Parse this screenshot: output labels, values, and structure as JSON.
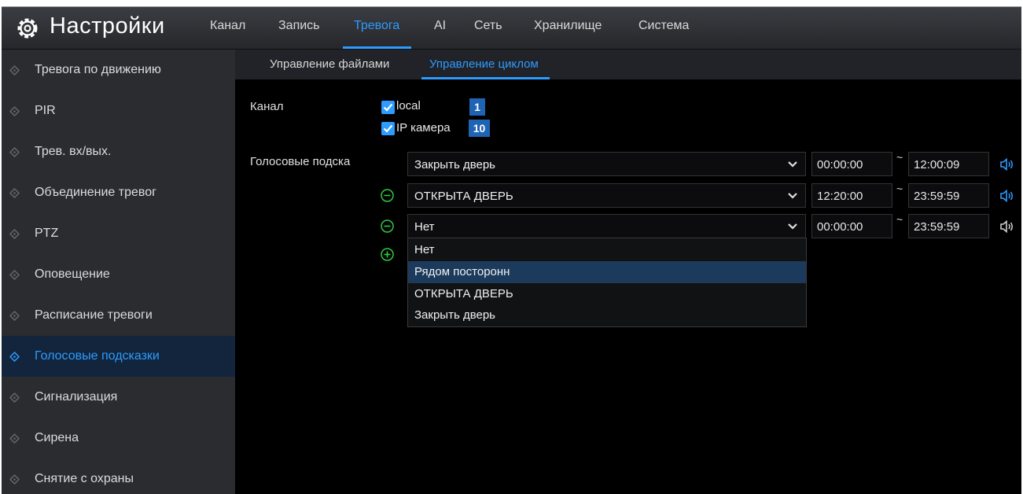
{
  "header": {
    "title": "Настройки",
    "tabs": [
      {
        "label": "Канал"
      },
      {
        "label": "Запись"
      },
      {
        "label": "Тревога"
      },
      {
        "label": "AI"
      },
      {
        "label": "Сеть"
      },
      {
        "label": "Хранилище"
      },
      {
        "label": "Система"
      }
    ],
    "active_tab": "Тревога"
  },
  "sidebar": {
    "items": [
      {
        "label": "Тревога по движению"
      },
      {
        "label": "PIR"
      },
      {
        "label": "Трев. вх/вых."
      },
      {
        "label": "Объединение тревог"
      },
      {
        "label": "PTZ"
      },
      {
        "label": "Оповещение"
      },
      {
        "label": "Расписание тревоги"
      },
      {
        "label": "Голосовые подсказки"
      },
      {
        "label": "Сигнализация"
      },
      {
        "label": "Сирена"
      },
      {
        "label": "Снятие с охраны"
      }
    ],
    "active_item": "Голосовые подсказки"
  },
  "subtabs": [
    {
      "label": "Управление файлами"
    },
    {
      "label": "Управление циклом"
    }
  ],
  "channel": {
    "label": "Канал",
    "options": [
      {
        "label": "local",
        "checked": true,
        "count": "1"
      },
      {
        "label": "IP камера",
        "checked": true,
        "count": "10"
      }
    ]
  },
  "voice_prompts": {
    "label": "Голосовые подска",
    "rows": [
      {
        "selected": "Закрыть дверь",
        "start": "00:00:00",
        "end": "12:00:09",
        "sound_active": true
      },
      {
        "selected": "ОТКРЫТА ДВЕРЬ",
        "start": "12:20:00",
        "end": "23:59:59",
        "sound_active": true
      },
      {
        "selected": "Нет",
        "start": "00:00:00",
        "end": "23:59:59",
        "sound_active": false
      }
    ],
    "range_separator": "~",
    "dropdown_options": [
      "Нет",
      "Рядом посторонн",
      "ОТКРЫТА ДВЕРЬ",
      "Закрыть дверь"
    ],
    "dropdown_highlighted": "Рядом посторонн"
  },
  "colors": {
    "accent": "#2e9bff",
    "add_remove": "#2ecc40",
    "background": "#000000",
    "sidebar": "#2a2c30"
  },
  "icons": {
    "header": "gear-icon",
    "sidebar": "diamond-bullet-icon",
    "speaker": "speaker-icon",
    "remove": "minus-circle-icon",
    "add": "plus-circle-icon",
    "dropdown": "chevron-down-icon"
  }
}
